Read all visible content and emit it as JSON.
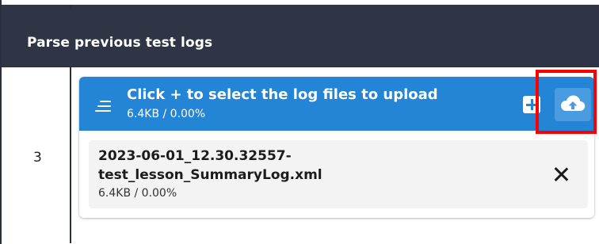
{
  "section": {
    "title": "Parse previous test logs"
  },
  "row": {
    "number": "3"
  },
  "uploader": {
    "prompt": "Click + to select the log files to upload",
    "total_progress": "6.4KB / 0.00%",
    "icons": {
      "menu": "menu-icon",
      "add": "plus-icon",
      "upload": "cloud-upload-icon",
      "remove": "close-icon"
    },
    "colors": {
      "header_bg": "#2f3545",
      "uploader_header_bg": "#2484d6",
      "highlight": "#ff0000"
    },
    "files": [
      {
        "name": "2023-06-01_12.30.32557-test_lesson_SummaryLog.xml",
        "name_line1": "2023-06-01_12.30.32557-",
        "name_line2": "test_lesson_SummaryLog.xml",
        "progress": "6.4KB / 0.00%"
      }
    ]
  }
}
